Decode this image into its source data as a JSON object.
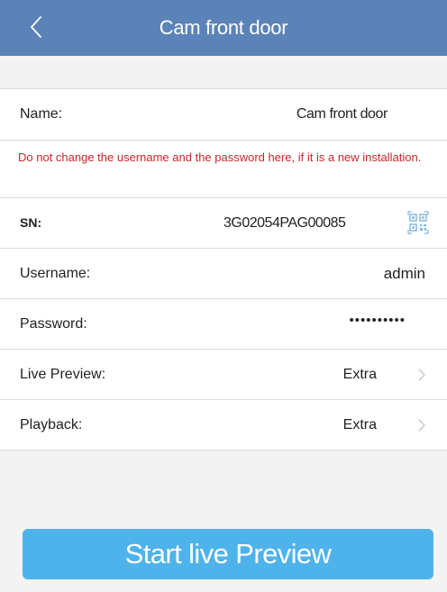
{
  "header": {
    "title": "Cam front door"
  },
  "fields": {
    "name": {
      "label": "Name:",
      "value": "Cam front door"
    },
    "warning": "Do not change the username and the password here, if it is a new installation.",
    "sn": {
      "label": "SN:",
      "value": "3G02054PAG00085"
    },
    "username": {
      "label": "Username:",
      "value": "admin"
    },
    "password": {
      "label": "Password:",
      "value": "••••••••••"
    },
    "live_preview": {
      "label": "Live Preview:",
      "value": "Extra"
    },
    "playback": {
      "label": "Playback:",
      "value": "Extra"
    }
  },
  "actions": {
    "start_label": "Start live Preview"
  },
  "colors": {
    "header": "#5b83b8",
    "warning": "#c8262c",
    "button": "#4eb3ea",
    "qr_icon": "#7fb6e2"
  },
  "icons": {
    "back": "chevron-left-icon",
    "scan": "qr-code-icon",
    "chevron": "chevron-right-icon"
  }
}
